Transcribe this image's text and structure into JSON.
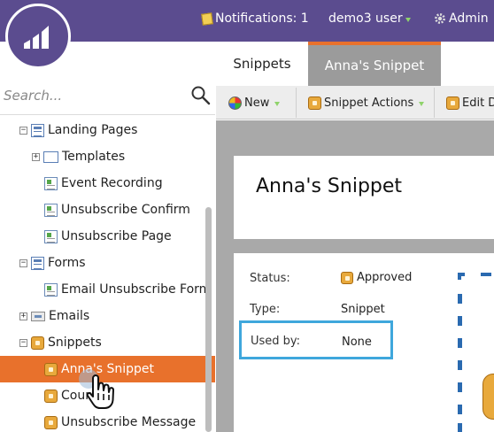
{
  "topbar": {
    "notifications": "Notifications: 1",
    "user": "demo3 user",
    "admin": "Admin"
  },
  "search": {
    "placeholder": "Search..."
  },
  "tree": {
    "landing_pages": "Landing Pages",
    "templates": "Templates",
    "event_recording": "Event Recording",
    "unsubscribe_confirm": "Unsubscribe Confirm",
    "unsubscribe_page": "Unsubscribe Page",
    "forms": "Forms",
    "email_unsubscribe_form": "Email Unsubscribe Form",
    "emails": "Emails",
    "snippets": "Snippets",
    "annas_snippet": "Anna's Snippet",
    "count": "Coun",
    "unsubscribe_message": "Unsubscribe Message"
  },
  "tabs": {
    "snippets": "Snippets",
    "annas_snippet": "Anna's Snippet"
  },
  "toolbar": {
    "new": "New",
    "snippet_actions": "Snippet Actions",
    "edit": "Edit D"
  },
  "main": {
    "title": "Anna's Snippet",
    "status_label": "Status:",
    "status_value": "Approved",
    "type_label": "Type:",
    "type_value": "Snippet",
    "used_by_label": "Used by:",
    "used_by_value": "None"
  },
  "colors": {
    "brand": "#5b4c8f",
    "selected": "#e8712c",
    "highlight": "#3fa7dc"
  }
}
